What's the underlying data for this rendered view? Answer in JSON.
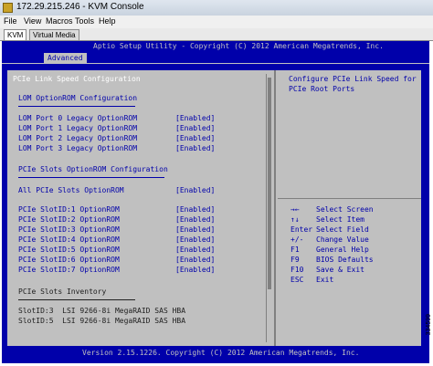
{
  "window": {
    "title": "172.29.215.246 - KVM Console"
  },
  "menu": [
    "File",
    "View",
    "Macros",
    "Tools",
    "Help"
  ],
  "tabs": [
    "KVM",
    "Virtual Media"
  ],
  "bios": {
    "banner": "Aptio Setup Utility - Copyright (C) 2012 American Megatrends, Inc.",
    "active_tab": "Advanced",
    "heading": "PCIe Link Speed Configuration",
    "lom_section": "LOM OptionROM Configuration",
    "lom_items": [
      {
        "label": "LOM Port 0 Legacy OptionROM",
        "value": "[Enabled]"
      },
      {
        "label": "LOM Port 1 Legacy OptionROM",
        "value": "[Enabled]"
      },
      {
        "label": "LOM Port 2 Legacy OptionROM",
        "value": "[Enabled]"
      },
      {
        "label": "LOM Port 3 Legacy OptionROM",
        "value": "[Enabled]"
      }
    ],
    "slots_section": "PCIe Slots OptionROM Configuration",
    "all_slots": {
      "label": "All PCIe Slots OptionROM",
      "value": "[Enabled]"
    },
    "slot_items": [
      {
        "label": "PCIe SlotID:1 OptionROM",
        "value": "[Enabled]"
      },
      {
        "label": "PCIe SlotID:2 OptionROM",
        "value": "[Enabled]"
      },
      {
        "label": "PCIe SlotID:3 OptionROM",
        "value": "[Enabled]"
      },
      {
        "label": "PCIe SlotID:4 OptionROM",
        "value": "[Enabled]"
      },
      {
        "label": "PCIe SlotID:5 OptionROM",
        "value": "[Enabled]"
      },
      {
        "label": "PCIe SlotID:6 OptionROM",
        "value": "[Enabled]"
      },
      {
        "label": "PCIe SlotID:7 OptionROM",
        "value": "[Enabled]"
      }
    ],
    "inventory_section": "PCIe Slots Inventory",
    "inventory": [
      "SlotID:3  LSI 9266-8i MegaRAID SAS HBA",
      "SlotID:5  LSI 9266-8i MegaRAID SAS HBA"
    ],
    "help_text": [
      "Configure PCIe Link Speed for",
      "PCIe Root Ports"
    ],
    "keys": [
      {
        "key": "→←",
        "action": "Select Screen"
      },
      {
        "key": "↑↓",
        "action": "Select Item"
      },
      {
        "key": "Enter",
        "action": "Select Field"
      },
      {
        "key": "+/-",
        "action": "Change Value"
      },
      {
        "key": "F1",
        "action": "General Help"
      },
      {
        "key": "F9",
        "action": "BIOS Defaults"
      },
      {
        "key": "F10",
        "action": "Save & Exit"
      },
      {
        "key": "ESC",
        "action": "Exit"
      }
    ],
    "footer": "Version 2.15.1226. Copyright (C) 2012 American Megatrends, Inc."
  },
  "figure_id": "334599"
}
